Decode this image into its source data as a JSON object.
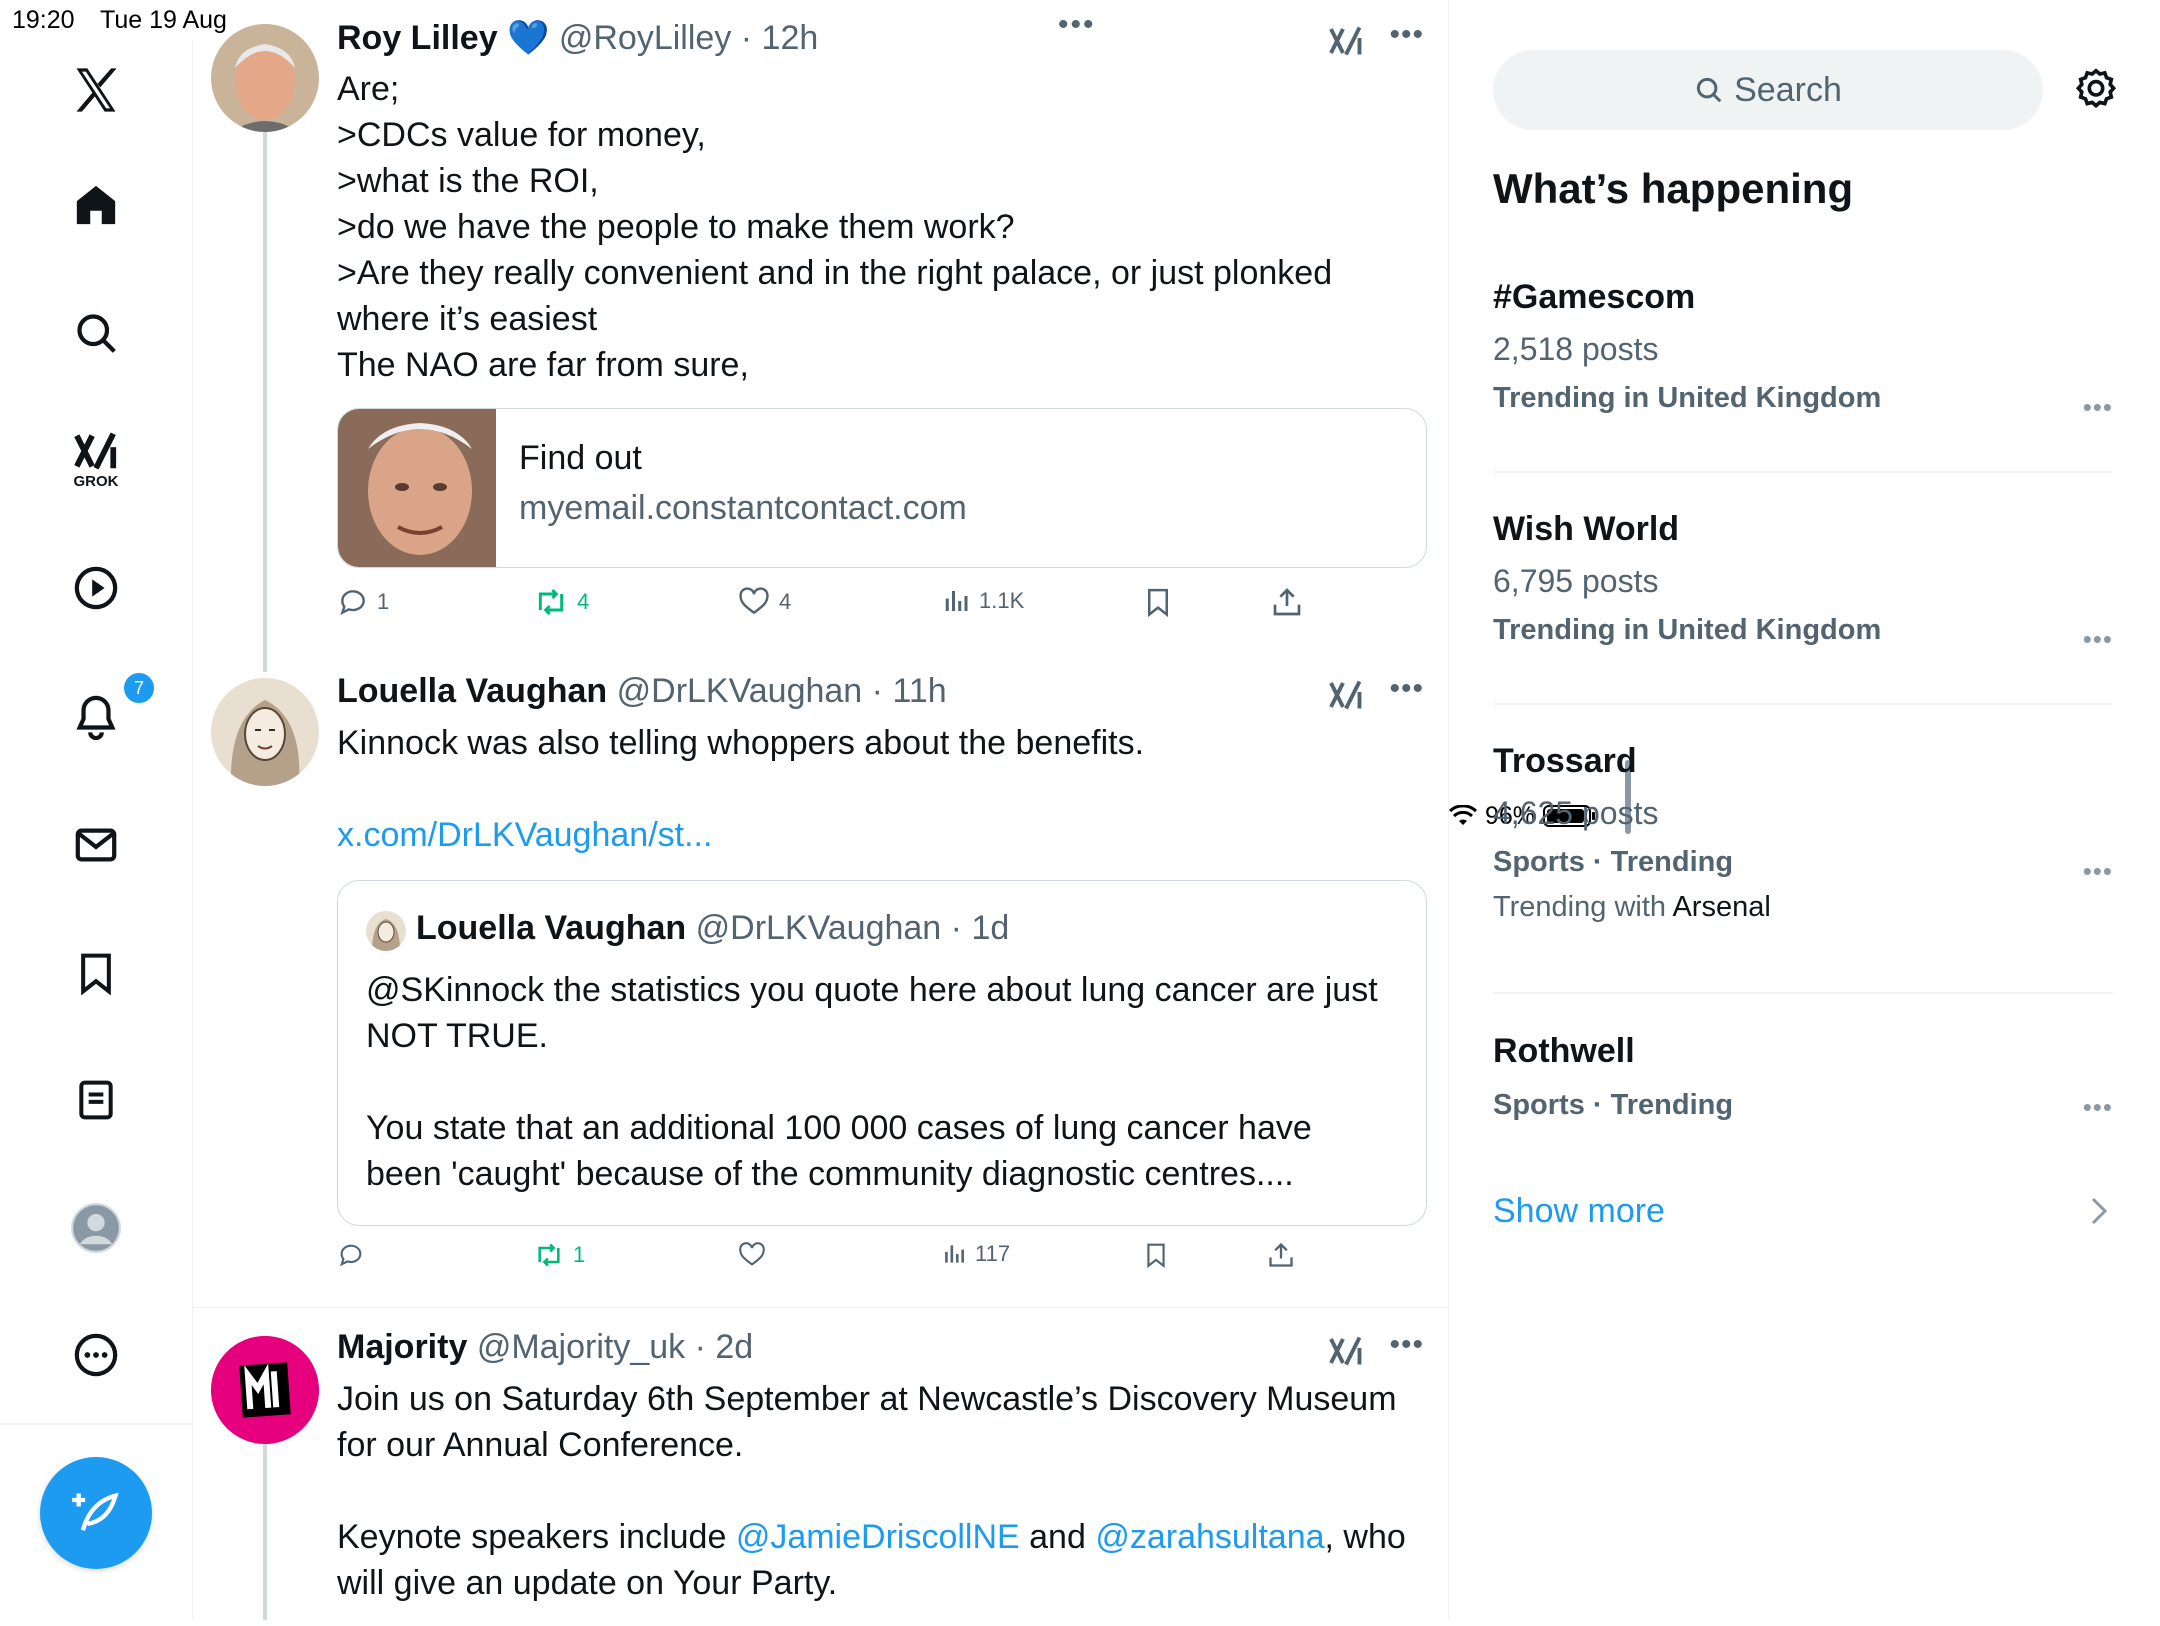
{
  "status_bar": {
    "time": "19:20",
    "date": "Tue 19 Aug",
    "battery": "96%"
  },
  "nav": {
    "grok_label": "GROK",
    "notifications_badge": "7"
  },
  "tweets": [
    {
      "name": "Roy Lilley",
      "verified_emoji": "💙",
      "handle": "@RoyLilley",
      "time": "· 12h",
      "lines": [
        "Are;",
        ">CDCs value for money,",
        ">what is the ROI,",
        ">do we have the people to make them work?",
        ">Are they really convenient and in the right palace, or just plonked",
        "where it’s easiest",
        "The NAO are far from sure,"
      ],
      "card": {
        "title": "Find out",
        "domain": "myemail.constantcontact.com"
      },
      "replies": "1",
      "reposts": "4",
      "likes": "4",
      "views": "1.1K"
    },
    {
      "name": "Louella Vaughan",
      "handle": "@DrLKVaughan",
      "time": "· 11h",
      "text": "Kinnock was also telling whoppers about the benefits.",
      "link": "x.com/DrLKVaughan/st...",
      "quote": {
        "name": "Louella Vaughan",
        "handle": "@DrLKVaughan",
        "time": "· 1d",
        "line1": "@SKinnock the statistics you quote here about lung cancer are just",
        "line2": "NOT TRUE.",
        "line3": "You state that an additional 100 000 cases of lung cancer have",
        "line4": "been 'caught' because of the community diagnostic centres...."
      },
      "replies": "",
      "reposts": "1",
      "likes": "",
      "views": "117"
    },
    {
      "name": "Majority",
      "handle": "@Majority_uk",
      "time": "· 2d",
      "line1": "Join us on Saturday 6th September at Newcastle’s Discovery Museum",
      "line2": "for our Annual Conference.",
      "line3_a": "Keynote speakers include ",
      "mention1": "@JamieDriscollNE",
      "line3_b": " and ",
      "mention2": "@zarahsultana",
      "line3_c": ", who",
      "line4": "will give an update on Your Party."
    }
  ],
  "sidebar": {
    "search_placeholder": "Search",
    "section_title": "What’s happening",
    "trends": [
      {
        "name": "#Gamescom",
        "posts": "2,518 posts",
        "context": "Trending in United Kingdom"
      },
      {
        "name": "Wish World",
        "posts": "6,795 posts",
        "context": "Trending in United Kingdom"
      },
      {
        "name": "Trossard",
        "posts": "4,625 posts",
        "context": "Sports · Trending",
        "with_prefix": "Trending with ",
        "with_name": "Arsenal"
      },
      {
        "name": "Rothwell",
        "posts": "",
        "context": "Sports · Trending"
      }
    ],
    "show_more": "Show more"
  },
  "colors": {
    "accent": "#1d9bf0",
    "repost": "#00ba7c",
    "secondary_text": "#536471",
    "majority_brand": "#e6007e"
  }
}
